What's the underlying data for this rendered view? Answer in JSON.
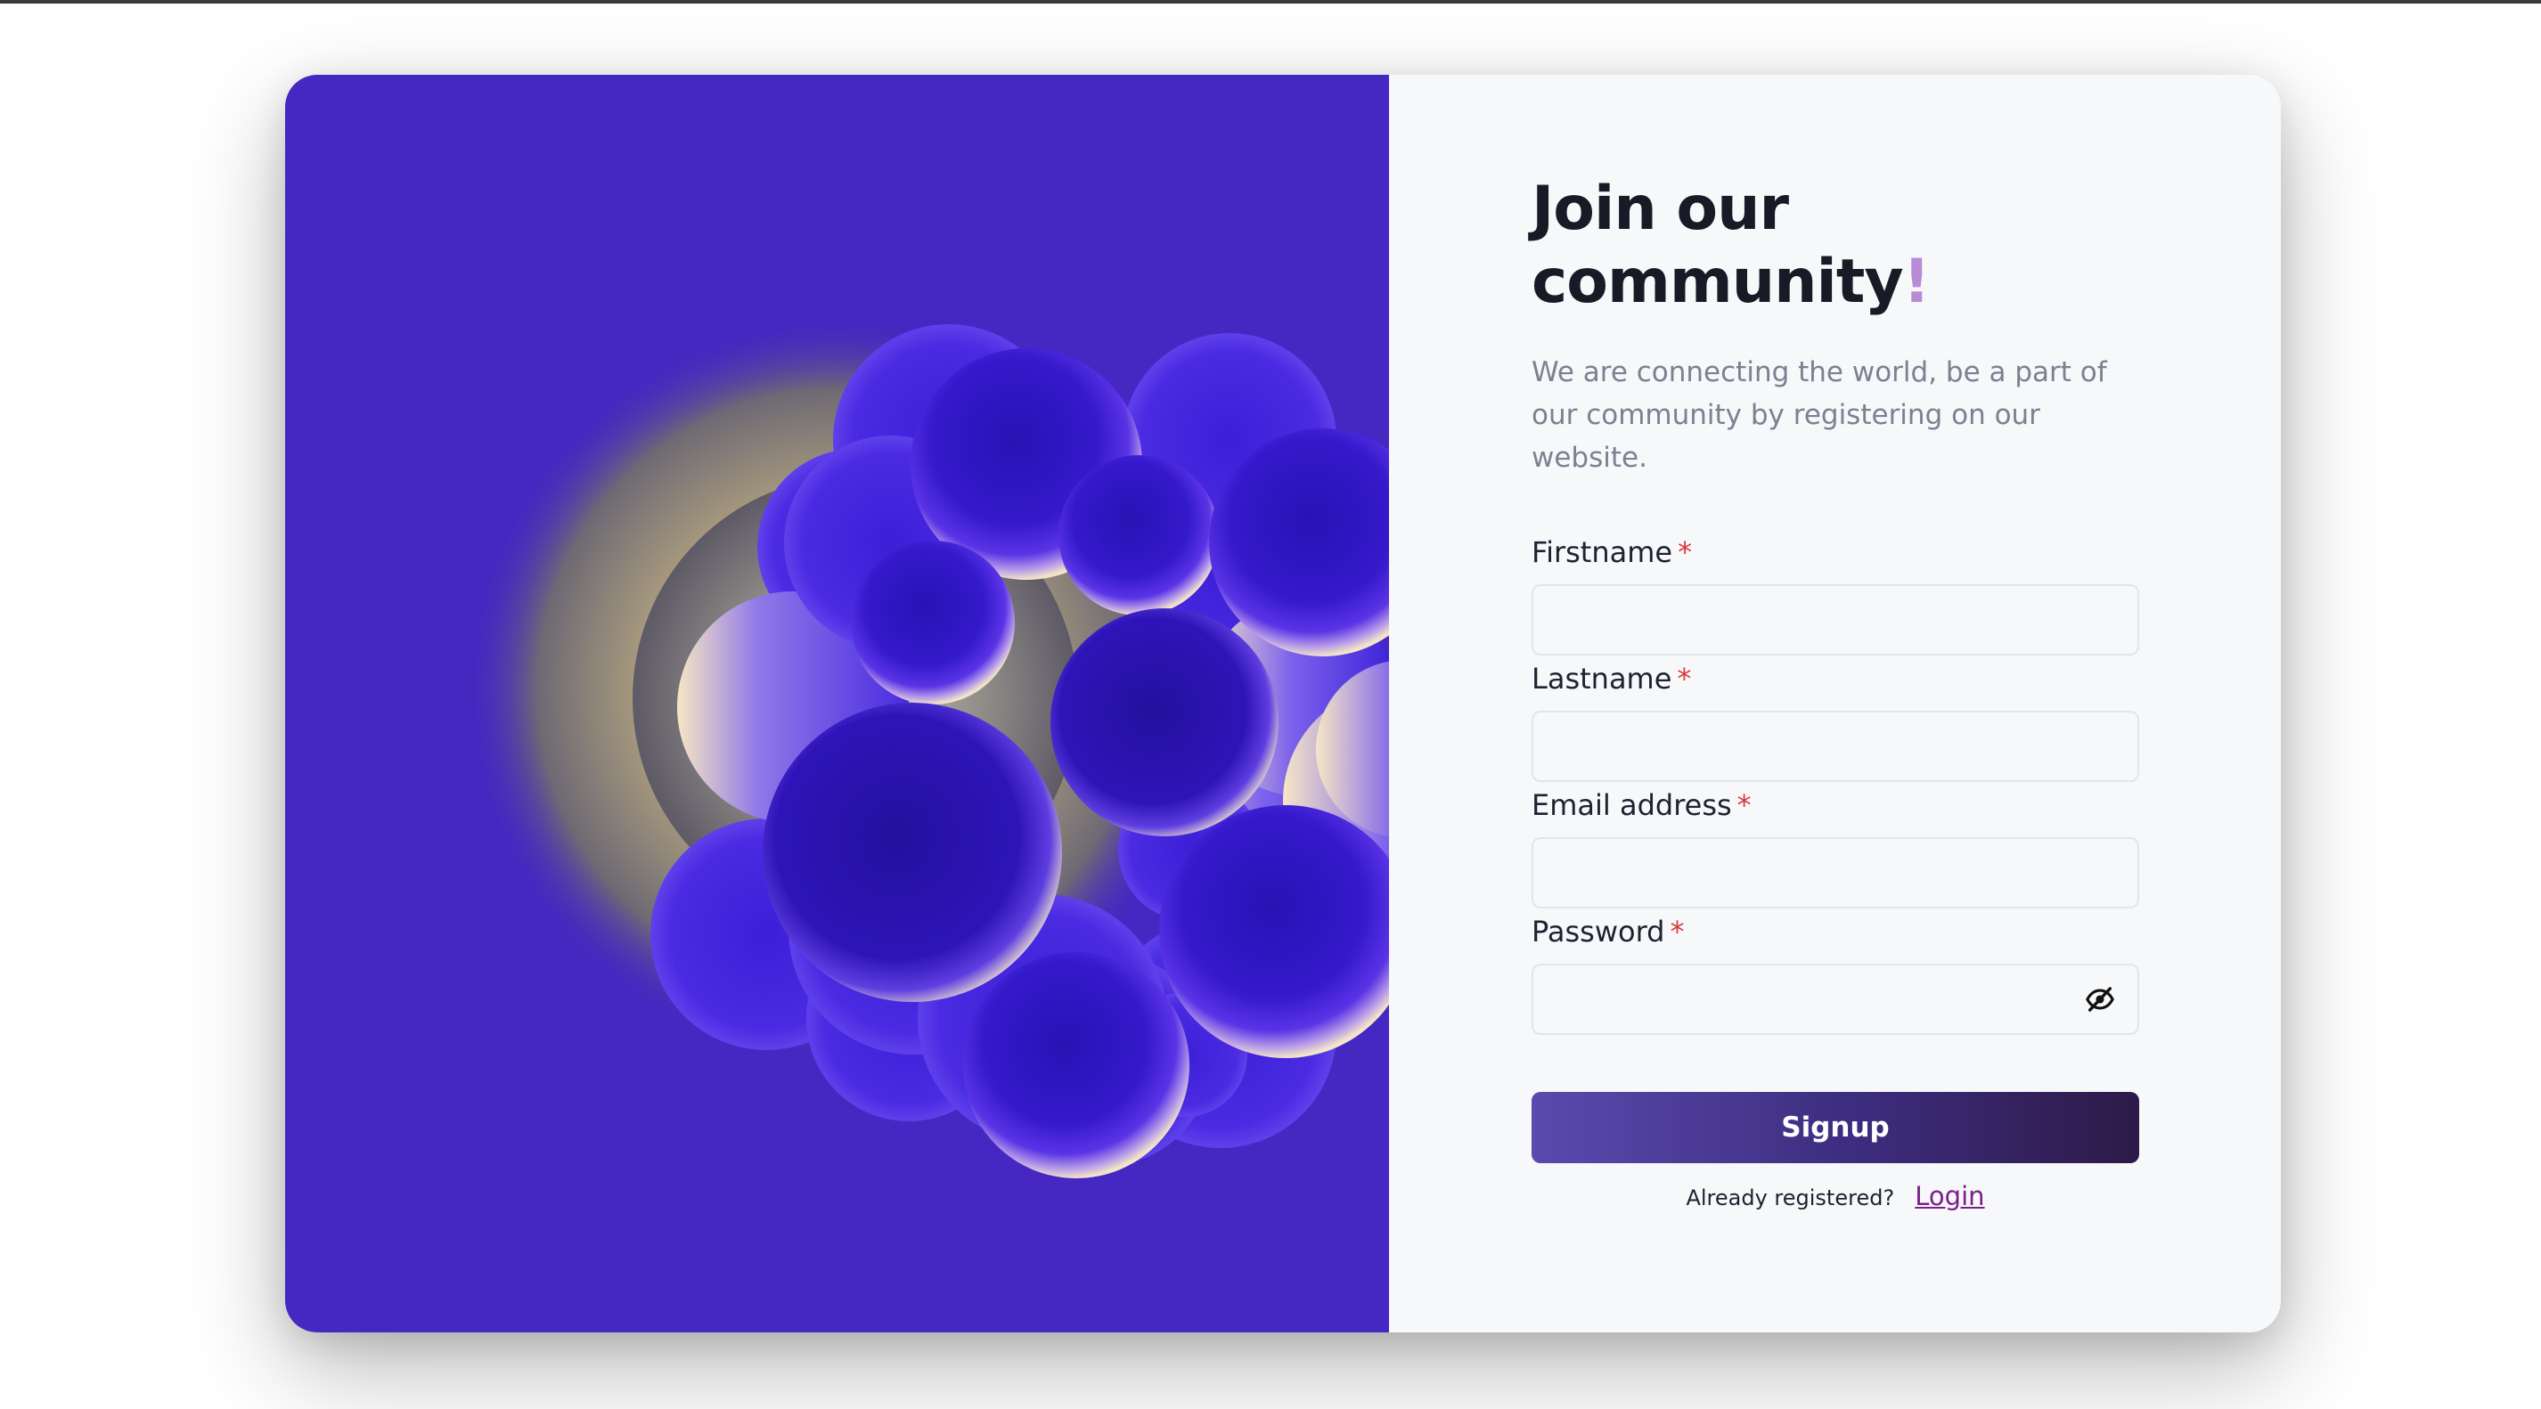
{
  "art": {
    "background_color": "#4527c1",
    "image_name": "purple-sphere-cluster-illustration"
  },
  "form": {
    "title_line1": "Join our",
    "title_line2": "community",
    "title_accent": "!",
    "subtitle": "We are connecting the world, be a part of our community by registering on our website.",
    "required_marker": "*",
    "fields": {
      "firstname": {
        "label": "Firstname",
        "value": "",
        "placeholder": ""
      },
      "lastname": {
        "label": "Lastname",
        "value": "",
        "placeholder": ""
      },
      "email": {
        "label": "Email address",
        "value": "",
        "placeholder": ""
      },
      "password": {
        "label": "Password",
        "value": "",
        "placeholder": "",
        "toggle_icon": "eye-slash-icon"
      }
    },
    "submit_label": "Signup",
    "already_registered": "Already registered?",
    "login_label": "Login"
  },
  "colors": {
    "accent": "#b98ad6",
    "required": "#d93a3a",
    "link": "#7b1f8a",
    "button_gradient_start": "#5a4aae",
    "button_gradient_end": "#2e1a47"
  }
}
